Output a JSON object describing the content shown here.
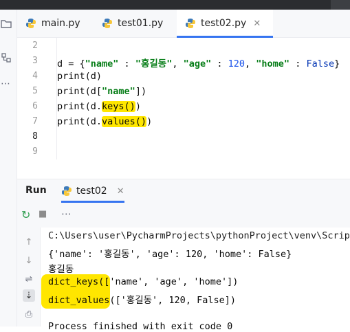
{
  "tabs": [
    {
      "label": "main.py",
      "active": false
    },
    {
      "label": "test01.py",
      "active": false
    },
    {
      "label": "test02.py",
      "active": true
    }
  ],
  "tab_close": "✕",
  "line_numbers": [
    "2",
    "3",
    "4",
    "5",
    "6",
    "7",
    "8",
    "9"
  ],
  "code": {
    "line3": {
      "d_assign": "d = {",
      "k_name": "\"name\"",
      "colon_sp": " : ",
      "v_name": "\"홍길동\"",
      "comma1": ", ",
      "k_age": "\"age\"",
      "v_age": "120",
      "comma2": ", ",
      "k_home": "\"home\"",
      "v_home": "False",
      "close": "}"
    },
    "line4": "print(d)",
    "line5_pre": "print(d[",
    "line5_key": "\"name\"",
    "line5_post": "])",
    "line6_pre": "print(d.",
    "line6_hl": "keys()",
    "line6_post": ")",
    "line7_pre": "print(d.",
    "line7_hl": "values()",
    "line7_post": ")"
  },
  "run_panel": {
    "title": "Run",
    "tab_label": "test02",
    "close": "✕"
  },
  "console": {
    "line1": "C:\\Users\\user\\PycharmProjects\\pythonProject\\venv\\Scripts\\",
    "line2": "{'name': '홍길동', 'age': 120, 'home': False}",
    "line3": "홍길동",
    "line4": "dict_keys(['name', 'age', 'home'])",
    "line5": "dict_values(['홍길동', 120, False])",
    "line6": "Process finished with exit code 0"
  },
  "icons": {
    "more": "⋯",
    "up": "↑",
    "down": "↓",
    "wrap": "⇌",
    "scroll_end": "⇣",
    "print": "⎙",
    "stop": "■",
    "rerun": "↻"
  },
  "colors": {
    "highlight": "#ffe600",
    "accent": "#3574f0",
    "string": "#067d17",
    "keyword_const": "#0033b3",
    "number": "#1750eb"
  }
}
